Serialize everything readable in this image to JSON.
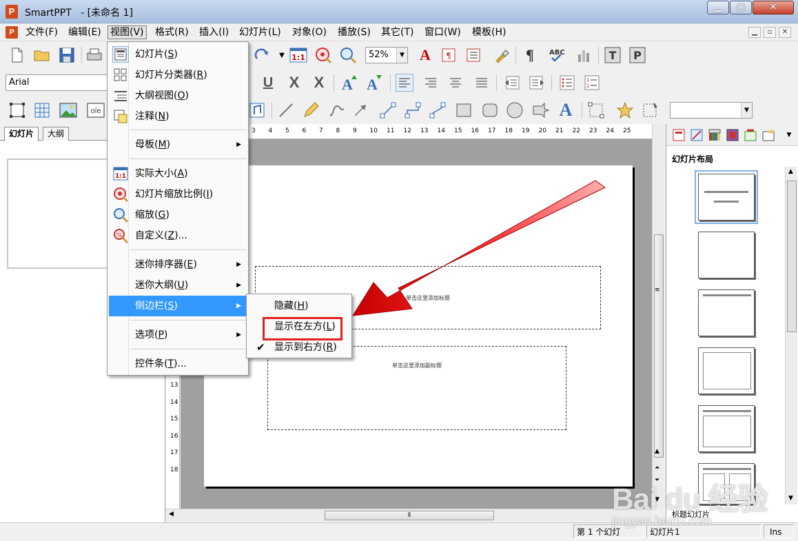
{
  "window": {
    "app_name": "SmartPPT",
    "doc_title": "- [未命名 1]",
    "logo_letter": "P",
    "min_glyph": "▁",
    "max_glyph": "□",
    "close_glyph": "✕"
  },
  "menubar": [
    {
      "label": "文件",
      "key": "(F)"
    },
    {
      "label": "编辑",
      "key": "(E)"
    },
    {
      "label": "视图",
      "key": "(V)"
    },
    {
      "label": "格式",
      "key": "(R)"
    },
    {
      "label": "插入",
      "key": "(I)"
    },
    {
      "label": "幻灯片",
      "key": "(L)"
    },
    {
      "label": "对象",
      "key": "(O)"
    },
    {
      "label": "播放",
      "key": "(S)"
    },
    {
      "label": "其它",
      "key": "(T)"
    },
    {
      "label": "窗口",
      "key": "(W)"
    },
    {
      "label": "模板",
      "key": "(H)"
    }
  ],
  "toolbar": {
    "zoom_value": "52%",
    "font_name": "Arial",
    "shape_combo_value": ""
  },
  "view_menu": {
    "items": [
      {
        "label": "幻灯片",
        "key": "S",
        "icon": "slide-icon"
      },
      {
        "label": "幻灯片分类器",
        "key": "R",
        "icon": "slide-sorter-icon"
      },
      {
        "label": "大纲视图",
        "key": "O",
        "icon": "outline-icon"
      },
      {
        "label": "注释",
        "key": "N",
        "icon": "notes-icon"
      },
      {
        "label": "母板",
        "key": "M"
      },
      {
        "label": "实际大小",
        "key": "A",
        "icon": "actual-size-icon"
      },
      {
        "label": "幻灯片缩放比例",
        "key": "I",
        "icon": "zoom-ratio-icon"
      },
      {
        "label": "缩放",
        "key": "G",
        "icon": "zoom-icon"
      },
      {
        "label": "自定义",
        "key": "Z",
        "suffix": "...",
        "icon": "custom-zoom-icon"
      },
      {
        "label": "迷你排序器",
        "key": "E"
      },
      {
        "label": "迷你大纲",
        "key": "U"
      },
      {
        "label": "侧边栏",
        "key": "S"
      },
      {
        "label": "选项",
        "key": "P"
      },
      {
        "label": "控件条",
        "key": "T",
        "suffix": "..."
      }
    ]
  },
  "sidebar_menu": {
    "items": [
      {
        "label": "隐藏",
        "key": "H"
      },
      {
        "label": "显示在左方",
        "key": "L"
      },
      {
        "label": "显示到右方",
        "key": "R",
        "checked": true
      }
    ]
  },
  "left_panel": {
    "tabs": [
      "幻灯片",
      "大纲"
    ]
  },
  "slide": {
    "title_placeholder": "单击这里添加标题",
    "subtitle_placeholder": "单击这里添加副标题"
  },
  "ruler": {
    "top_ticks": [
      "3",
      "4",
      "5",
      "6",
      "7",
      "8",
      "9",
      "10",
      "11",
      "12",
      "13",
      "14",
      "15",
      "16",
      "17",
      "18",
      "19",
      "20",
      "21",
      "22",
      "23",
      "24",
      "25"
    ],
    "left_ticks": [
      "13",
      "14",
      "15",
      "16",
      "17",
      "18"
    ]
  },
  "right_panel": {
    "title": "幻灯片布局",
    "bottom_label": "标题幻灯片"
  },
  "statusbar": {
    "slide_position": "第 1 个幻灯",
    "slide_name": "幻灯片1",
    "mode": "Ins"
  },
  "watermark": {
    "logo": "Bai du 经验",
    "url": "jingyan.baidu.com"
  }
}
